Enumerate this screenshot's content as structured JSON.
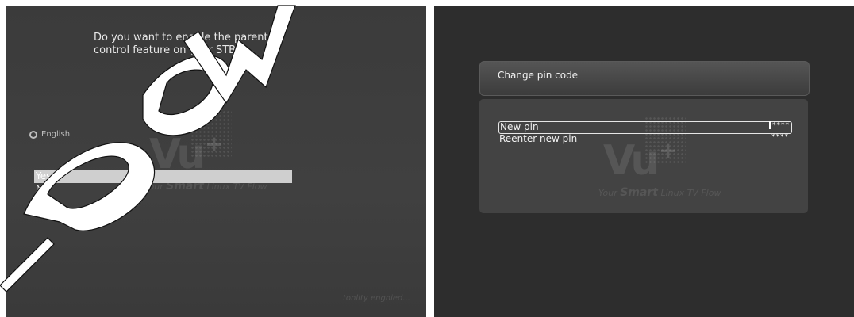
{
  "left_screen": {
    "question": "Do you want to enable the parental control feature on your STB?",
    "language": "English",
    "options": [
      "Yes",
      "No"
    ],
    "selected_option": "Yes",
    "hint": "tonlity engnied..."
  },
  "right_screen": {
    "title": "Change pin code",
    "fields": [
      {
        "label": "New pin",
        "value": "****",
        "focused": true
      },
      {
        "label": "Reenter new pin",
        "value": "****",
        "focused": false
      }
    ]
  },
  "logo": {
    "brand": "Vu",
    "plus": "+",
    "tagline_pre": "Your ",
    "tagline_bold": "Smart",
    "tagline_post": " Linux TV Flow"
  },
  "colors": {
    "screen_bg": "#3d3d3d",
    "right_bg": "#2d2d2d",
    "highlight": "#cfcfcf",
    "text": "#f2f2f2"
  }
}
